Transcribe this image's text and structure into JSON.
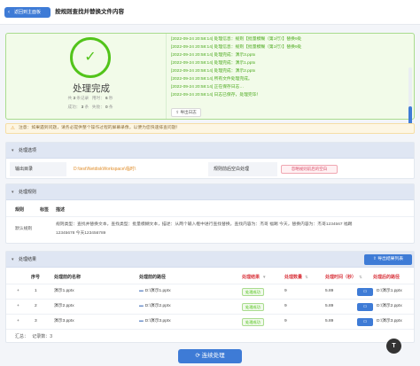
{
  "header": {
    "back_label": "返回到主面板",
    "title": "按规则查找并替换文件内容"
  },
  "result": {
    "status_title": "处理完成",
    "stats": {
      "total_label": "共",
      "total": "3",
      "total_unit": "条记录",
      "time_label": "用时：",
      "time": "6",
      "time_unit": "秒",
      "success_label": "成功：",
      "success": "3",
      "success_unit": "条",
      "fail_label": "失败：",
      "fail": "0",
      "fail_unit": "条"
    },
    "logs": [
      "[2022-09-24 20:58:14] 处理信息：规则【批量模糊（第1行）】替换9处",
      "[2022-09-24 20:58:14] 处理信息：规则【批量模糊（第1行）】替换9处",
      "[2022-09-24 20:58:14] 处理完成：演示3.pptx",
      "[2022-09-24 20:58:14] 处理完成：演示1.pptx",
      "[2022-09-24 20:58:14] 处理完成：演示2.pptx",
      "[2022-09-24 20:58:14] 所有文件处理完成。",
      "[2022-09-24 20:58:14] 正在保存日志…",
      "[2022-09-24 20:58:14] 日志已保存，处理完毕！"
    ],
    "export_log_label": "导出日志"
  },
  "notice": "注意：如果遇到问题，请务必提供整个操作过程的屏幕录像，以便为您快速排查问题！",
  "options": {
    "section_title": "处理选项",
    "output_dir_label": "输出目录",
    "output_dir_value": "D:\\test\\NetdiskWorkspace\\临时\\",
    "empty_rule_label": "规则前后空白处理",
    "empty_rule_value": "忽略规则前后的空白"
  },
  "rules": {
    "section_title": "处理规则",
    "headers": [
      "规则",
      "标签",
      "描述"
    ],
    "rows": [
      {
        "name": "默认规则",
        "desc_line1": "规则类型：查找并替换文本，查找类型：批量模糊文本，描述：从两个输入框中进行查找替换，查找内容为：杰哥 福踢 今天，替换内容为：杰哥1234567 福踢",
        "desc_line2": "12345678 今天123456789"
      }
    ]
  },
  "results": {
    "section_title": "处理结果",
    "export_label": "导出结果列表",
    "headers": {
      "seq": "序号",
      "before_name": "处理前的名称",
      "before_path": "处理前的路径",
      "status": "处理结果",
      "count": "处理数量",
      "time": "处理时间（秒）",
      "after_path": "处理后的路径"
    },
    "rows": [
      {
        "seq": "1",
        "name": "演示1.pptx",
        "path": "D:\\演示1.pptx",
        "status": "处理成功",
        "count": "9",
        "time": "5.89",
        "after": "D:\\演示1.pptx"
      },
      {
        "seq": "2",
        "name": "演示2.pptx",
        "path": "D:\\演示2.pptx",
        "status": "处理成功",
        "count": "9",
        "time": "5.89",
        "after": "D:\\演示2.pptx"
      },
      {
        "seq": "3",
        "name": "演示3.pptx",
        "path": "D:\\演示3.pptx",
        "status": "处理成功",
        "count": "9",
        "time": "5.89",
        "after": "D:\\演示3.pptx"
      }
    ],
    "summary_label": "汇总：",
    "summary_count": "记录数：3"
  },
  "footer": {
    "continue_label": "连续处理"
  }
}
